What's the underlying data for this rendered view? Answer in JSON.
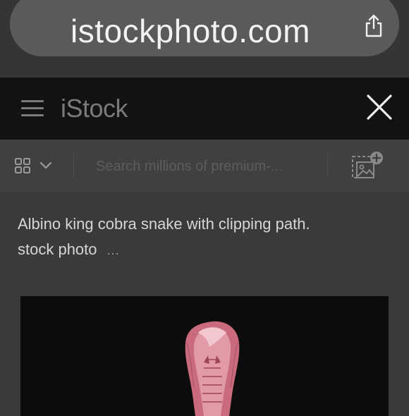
{
  "browser": {
    "url": "istockphoto.com",
    "share_icon": "share-icon"
  },
  "header": {
    "menu_icon": "hamburger-icon",
    "logo": "iStock",
    "close_icon": "close-icon"
  },
  "search": {
    "view_icon": "grid-icon",
    "dropdown_icon": "chevron-down-icon",
    "placeholder": "Search millions of premium-...",
    "visual_search_icon": "image-search-icon"
  },
  "asset": {
    "title": "Albino king cobra snake with clipping path.",
    "type": "stock photo",
    "more": "..."
  },
  "colors": {
    "background": "#3a3a3a",
    "header": "#121212",
    "image_bg": "#0c0c0c",
    "snake": "#c96b7c"
  }
}
